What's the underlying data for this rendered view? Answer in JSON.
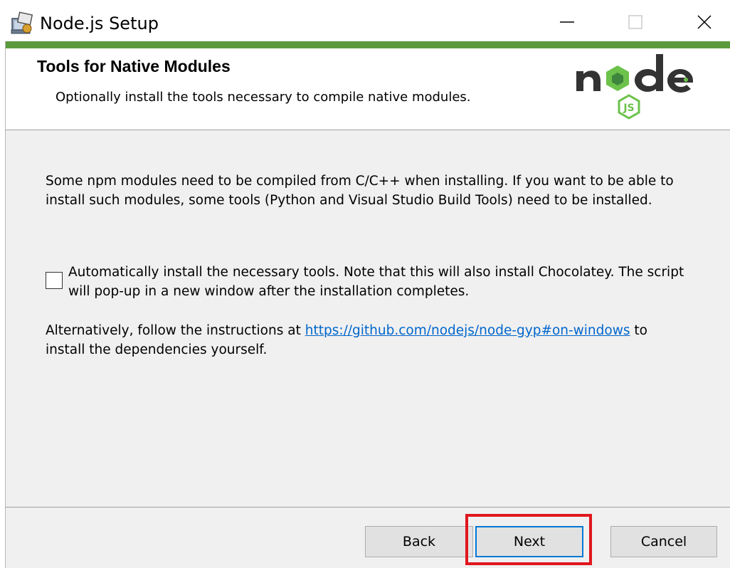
{
  "window": {
    "title": "Node.js Setup",
    "accent_color": "#5b9a3c",
    "app_icon": "installer-icon",
    "controls": {
      "minimize_icon": "minimize-icon",
      "maximize_icon": "maximize-icon",
      "close_icon": "close-icon"
    }
  },
  "banner": {
    "title": "Tools for Native Modules",
    "subtitle": "Optionally install the tools necessary to compile native modules.",
    "logo_text": "node",
    "logo_badge": "JS"
  },
  "content": {
    "paragraph1_line1": "Some npm modules need to be compiled from C/C++ when installing. If you want to be able to",
    "paragraph1_line2": "install such modules, some tools (Python and Visual Studio Build Tools) need to be installed.",
    "checkbox": {
      "checked": false,
      "label_line1": "Automatically install the necessary tools. Note that this will also install Chocolatey. The script",
      "label_line2": "will pop-up in a new window after the installation completes."
    },
    "paragraph3_prefix": "Alternatively, follow the instructions at ",
    "paragraph3_link": "https://github.com/nodejs/node-gyp#on-windows",
    "paragraph3_suffix": " to",
    "paragraph3_line2": "install the dependencies yourself.",
    "link_color": "#0066cc"
  },
  "footer": {
    "back_label": "Back",
    "next_label": "Next",
    "cancel_label": "Cancel",
    "highlight_color": "#e0161e"
  }
}
